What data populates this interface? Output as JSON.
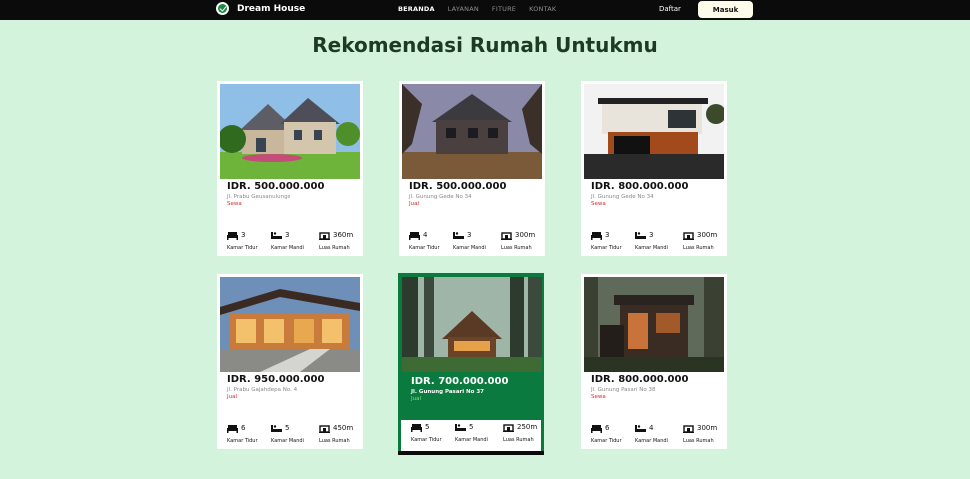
{
  "brand": {
    "name": "Dream House"
  },
  "nav": {
    "links": [
      "BERANDA",
      "LAYANAN",
      "FITURE",
      "KONTAK"
    ],
    "active": "BERANDA",
    "register": "Daftar",
    "login": "Masuk"
  },
  "page": {
    "title": "Rekomendasi Rumah Untukmu"
  },
  "labels": {
    "bedroom": "Kamar Tidur",
    "bathroom": "Kamar Mandi",
    "area": "Luas Rumah"
  },
  "cards": [
    {
      "price": "IDR. 500.000.000",
      "address": "Jl. Prabu Geusanulungs",
      "status": "Sewa",
      "bedrooms": "3",
      "bathrooms": "3",
      "area": "360m"
    },
    {
      "price": "IDR. 500.000.000",
      "address": "Jl. Gunung Gede No 34",
      "status": "Jual",
      "bedrooms": "4",
      "bathrooms": "3",
      "area": "300m"
    },
    {
      "price": "IDR. 800.000.000",
      "address": "Jl. Gunung Gede No 34",
      "status": "Sewa",
      "bedrooms": "3",
      "bathrooms": "3",
      "area": "300m"
    },
    {
      "price": "IDR. 950.000.000",
      "address": "Jl. Prabu Gajahdepa No. 4",
      "status": "Jual",
      "bedrooms": "6",
      "bathrooms": "5",
      "area": "450m"
    },
    {
      "price": "IDR. 700.000.000",
      "address": "Jl. Gunung Pasari No 37",
      "status": "Jual",
      "bedrooms": "5",
      "bathrooms": "5",
      "area": "250m",
      "highlighted": true
    },
    {
      "price": "IDR. 800.000.000",
      "address": "Jl. Gunung Pasari No 38",
      "status": "Sewa",
      "bedrooms": "6",
      "bathrooms": "4",
      "area": "300m"
    }
  ]
}
